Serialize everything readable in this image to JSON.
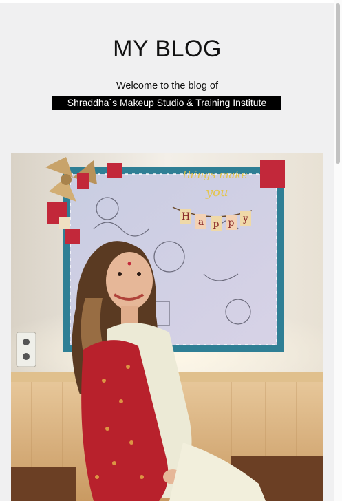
{
  "blog": {
    "title": "MY BLOG",
    "welcome_text": "Welcome to the blog of",
    "studio_name": "Shraddha`s Makeup Studio & Training Institute"
  },
  "featured_image": {
    "description_icon": "portrait-photo",
    "wall_art_text": "things make you happy",
    "banner_letters": [
      "H",
      "a",
      "p",
      "p",
      "y"
    ]
  },
  "colors": {
    "page_background": "#f0f0f1",
    "title_text": "#111111",
    "highlight_background": "#000000",
    "highlight_text": "#ffffff",
    "scroll_thumb": "#c2c2c2"
  }
}
